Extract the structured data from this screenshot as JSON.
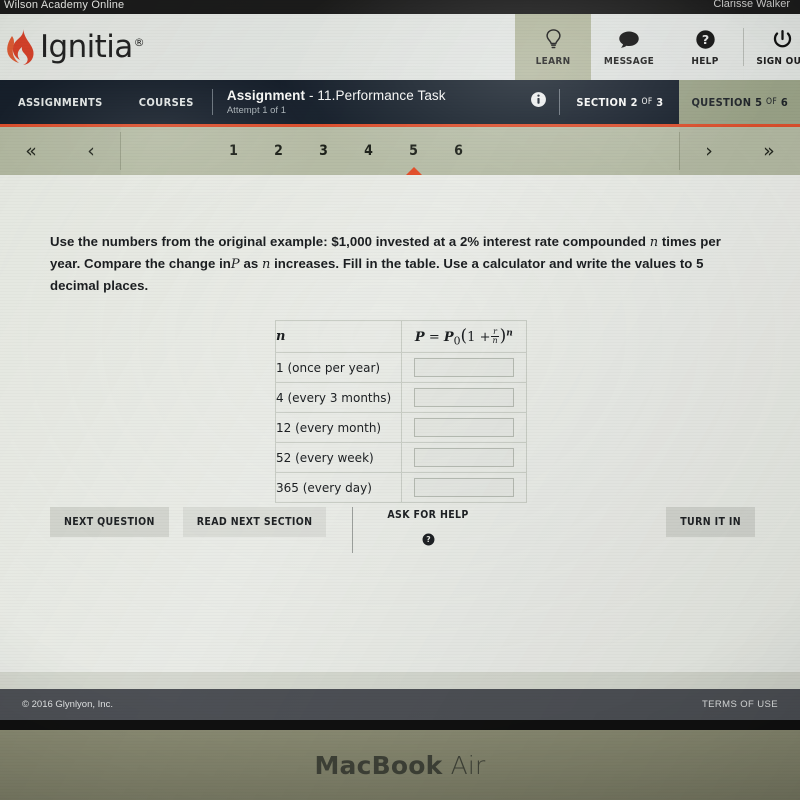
{
  "browser": {
    "tab_title": "Wilson Academy Online",
    "user_name": "Clarisse Walker"
  },
  "header": {
    "brand": "Ignitia",
    "brand_registered": "®",
    "brand_icon": "flame-icon",
    "utility_nav": [
      {
        "label": "LEARN",
        "icon": "lightbulb-icon",
        "active": true
      },
      {
        "label": "MESSAGE",
        "icon": "speech-bubble-icon",
        "active": false
      },
      {
        "label": "HELP",
        "icon": "question-circle-icon",
        "active": false
      },
      {
        "label": "SIGN OUT",
        "icon": "power-icon",
        "active": false
      }
    ]
  },
  "assignment_bar": {
    "nav": [
      {
        "label": "ASSIGNMENTS"
      },
      {
        "label": "COURSES"
      }
    ],
    "title_label": "Assignment",
    "title_separator": " - ",
    "title_value": "11.Performance Task",
    "attempt": "Attempt 1 of 1",
    "info_icon": "info-circle-icon",
    "section_prefix": "SECTION",
    "section_current": "2",
    "section_of": "OF",
    "section_total": "3",
    "question_prefix": "QUESTION",
    "question_current": "5",
    "question_of": "OF",
    "question_total": "6"
  },
  "pager": {
    "first_icon": "double-chevron-left-icon",
    "prev_icon": "chevron-left-icon",
    "next_icon": "chevron-right-icon",
    "last_icon": "double-chevron-right-icon",
    "first_glyph": "«",
    "prev_glyph": "‹",
    "next_glyph": "›",
    "last_glyph": "»",
    "numbers": [
      "1",
      "2",
      "3",
      "4",
      "5",
      "6"
    ],
    "current": "5"
  },
  "question": {
    "text_part1": "Use the numbers from the original example: $1,000 invested at a 2% interest rate compounded ",
    "var_n_1": "n",
    "text_part2": " times per year. Compare the change in",
    "var_P": "P",
    "text_part3": " as ",
    "var_n_2": "n",
    "text_part4": " increases. Fill in the table. Use a calculator and write the values to 5 decimal places."
  },
  "table": {
    "header_n": "n",
    "header_formula_plain": "P = P0(1 + r/n)^n",
    "formula": {
      "P": "P",
      "equals": "=",
      "P0": "P",
      "P0sub": "0",
      "open": "(",
      "one_plus": "1 +",
      "num": "r",
      "den": "n",
      "close": ")",
      "exp": "n"
    },
    "rows": [
      {
        "n_label": "1 (once per year)",
        "value": ""
      },
      {
        "n_label": "4 (every 3 months)",
        "value": ""
      },
      {
        "n_label": "12 (every month)",
        "value": ""
      },
      {
        "n_label": "52 (every week)",
        "value": ""
      },
      {
        "n_label": "365 (every day)",
        "value": ""
      }
    ],
    "input_placeholder": ""
  },
  "actions": {
    "next_question": "NEXT QUESTION",
    "read_next_section": "READ NEXT SECTION",
    "ask_for_help": "ASK FOR HELP",
    "ask_for_help_icon": "question-circle-icon",
    "turn_it_in": "TURN IT IN"
  },
  "footer": {
    "copyright": "© 2016 Glynlyon, Inc.",
    "terms": "TERMS OF USE"
  },
  "device": {
    "brand_bold": "MacBook",
    "brand_light": " Air"
  },
  "colors": {
    "accent_orange": "#e1502d",
    "dark_navy": "#16202c",
    "pager_green": "#b7bda7",
    "footer_gray": "#4e5157",
    "page_bg": "#eef0ec"
  }
}
